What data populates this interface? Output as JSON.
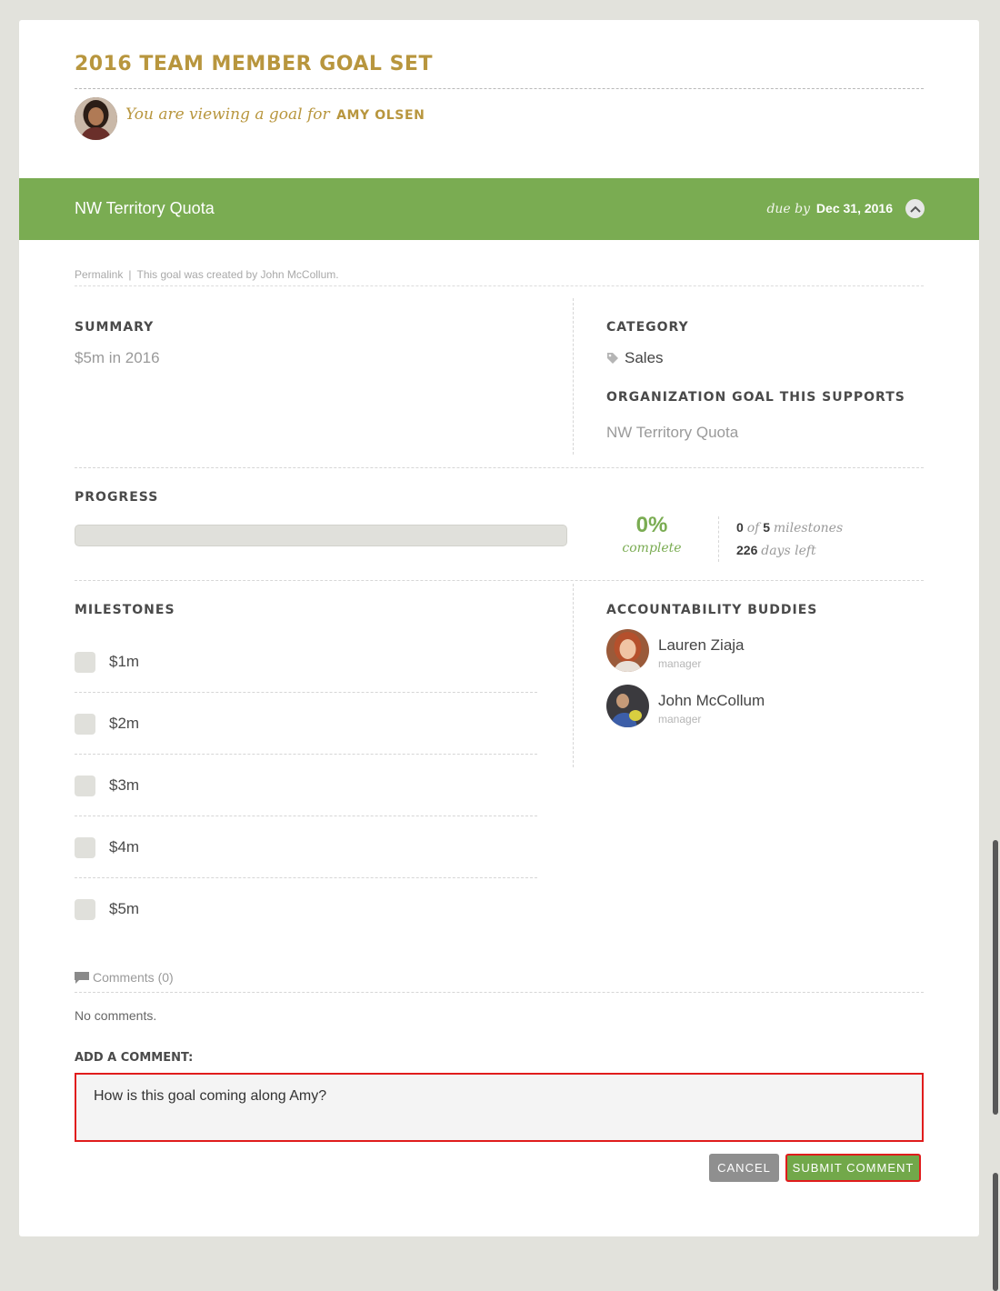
{
  "header": {
    "title": "2016 TEAM MEMBER GOAL SET",
    "viewing_text": "You are viewing a goal for",
    "owner_name": "AMY OLSEN"
  },
  "goal": {
    "name": "NW Territory Quota",
    "due_label": "due by",
    "due_date": "Dec 31, 2016",
    "permalink": "Permalink",
    "created_by": "This goal was created by John McCollum."
  },
  "summary": {
    "label": "SUMMARY",
    "value": "$5m in 2016"
  },
  "category": {
    "label": "CATEGORY",
    "value": "Sales",
    "icon": "tag-icon"
  },
  "org_goal": {
    "label": "ORGANIZATION GOAL THIS SUPPORTS",
    "value": "NW Territory Quota"
  },
  "progress": {
    "label": "PROGRESS",
    "percent_text": "0%",
    "percent_value": 0,
    "complete_label": "complete",
    "milestones_done": "0",
    "milestones_of": "of",
    "milestones_total": "5",
    "milestones_label": "milestones",
    "days_left": "226",
    "days_left_label": "days left"
  },
  "milestones": {
    "label": "MILESTONES",
    "items": [
      {
        "label": "$1m",
        "checked": false
      },
      {
        "label": "$2m",
        "checked": false
      },
      {
        "label": "$3m",
        "checked": false
      },
      {
        "label": "$4m",
        "checked": false
      },
      {
        "label": "$5m",
        "checked": false
      }
    ]
  },
  "buddies": {
    "label": "ACCOUNTABILITY BUDDIES",
    "items": [
      {
        "name": "Lauren Ziaja",
        "role": "manager"
      },
      {
        "name": "John McCollum",
        "role": "manager"
      }
    ]
  },
  "comments": {
    "header": "Comments (0)",
    "empty_text": "No comments.",
    "add_label": "ADD A COMMENT:",
    "draft": "How is this goal coming along Amy?",
    "cancel_label": "CANCEL",
    "submit_label": "SUBMIT COMMENT"
  },
  "colors": {
    "accent_gold": "#b8963e",
    "goal_green": "#7aac52",
    "highlight_red": "#e01c1c"
  }
}
